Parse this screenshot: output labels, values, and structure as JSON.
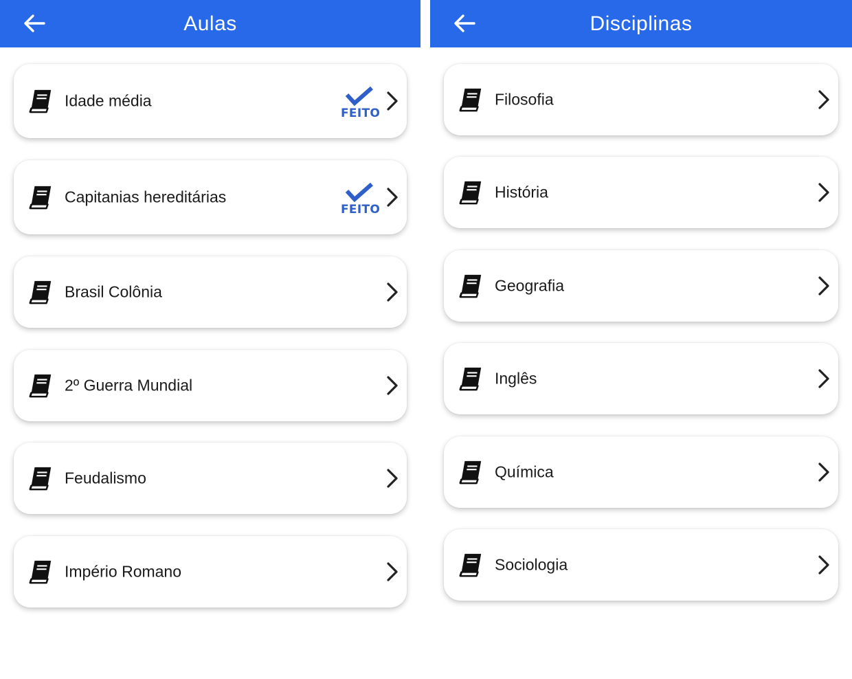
{
  "left_screen": {
    "title": "Aulas",
    "items": [
      {
        "label": "Idade média",
        "done": true
      },
      {
        "label": "Capitanias hereditárias",
        "done": true
      },
      {
        "label": "Brasil Colônia",
        "done": false
      },
      {
        "label": "2º Guerra Mundial",
        "done": false
      },
      {
        "label": "Feudalismo",
        "done": false
      },
      {
        "label": "Império Romano",
        "done": false
      }
    ]
  },
  "right_screen": {
    "title": "Disciplinas",
    "items": [
      {
        "label": "Filosofia"
      },
      {
        "label": "História"
      },
      {
        "label": "Geografia"
      },
      {
        "label": "Inglês"
      },
      {
        "label": "Química"
      },
      {
        "label": "Sociologia"
      }
    ]
  },
  "done_badge": {
    "text": "FEITO",
    "color": "#2f5fc8"
  },
  "colors": {
    "appbar": "#2769e8",
    "card": "#ffffff"
  },
  "icons": {
    "back": "arrow-left-icon",
    "item": "book-icon",
    "chevron": "chevron-right-icon",
    "done": "checkmark-icon"
  }
}
